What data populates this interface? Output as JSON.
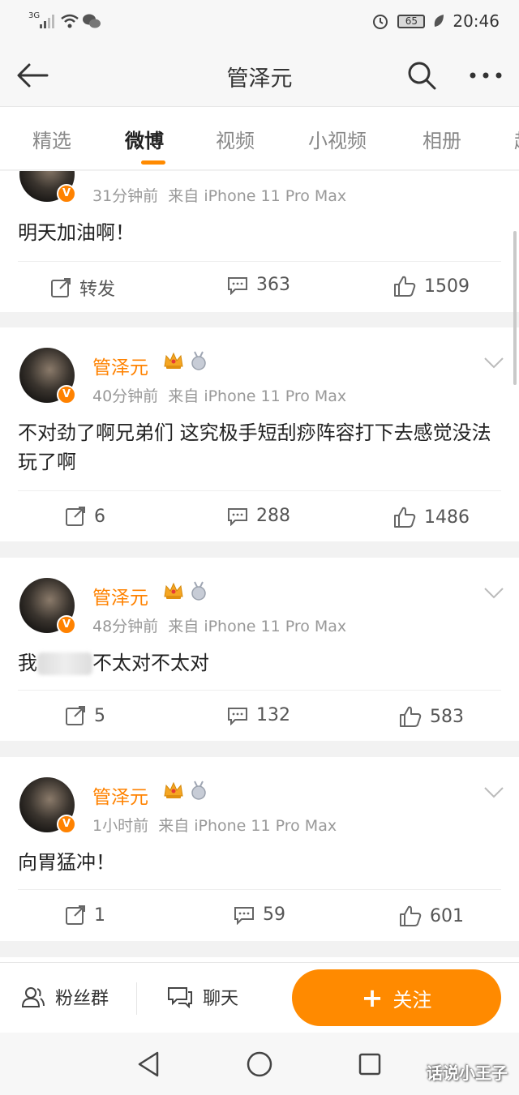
{
  "status_bar": {
    "network": "3G",
    "battery": "65",
    "time": "20:46"
  },
  "nav": {
    "title": "管泽元"
  },
  "tabs": [
    {
      "label": "精选"
    },
    {
      "label": "微博"
    },
    {
      "label": "视频"
    },
    {
      "label": "小视频"
    },
    {
      "label": "相册"
    },
    {
      "label": "超"
    }
  ],
  "posts": [
    {
      "name": "",
      "time": "31分钟前",
      "source": "来自 iPhone 11 Pro Max",
      "content": "明天加油啊！",
      "repost": "转发",
      "comments": "363",
      "likes": "1509"
    },
    {
      "name": "管泽元",
      "time": "40分钟前",
      "source": "来自 iPhone 11 Pro Max",
      "content": "不对劲了啊兄弟们 这究极手短刮痧阵容打下去感觉没法玩了啊",
      "repost": "6",
      "comments": "288",
      "likes": "1486"
    },
    {
      "name": "管泽元",
      "time": "48分钟前",
      "source": "来自 iPhone 11 Pro Max",
      "content_prefix": "我",
      "content": "不太对不太对",
      "repost": "5",
      "comments": "132",
      "likes": "583"
    },
    {
      "name": "管泽元",
      "time": "1小时前",
      "source": "来自 iPhone 11 Pro Max",
      "content": "向胃猛冲！",
      "repost": "1",
      "comments": "59",
      "likes": "601"
    }
  ],
  "bottom_bar": {
    "fans_group": "粉丝群",
    "chat": "聊天",
    "follow": "关注"
  },
  "watermark": "话说小王子",
  "colors": {
    "accent": "#ff8200",
    "button": "#ff8a00"
  }
}
